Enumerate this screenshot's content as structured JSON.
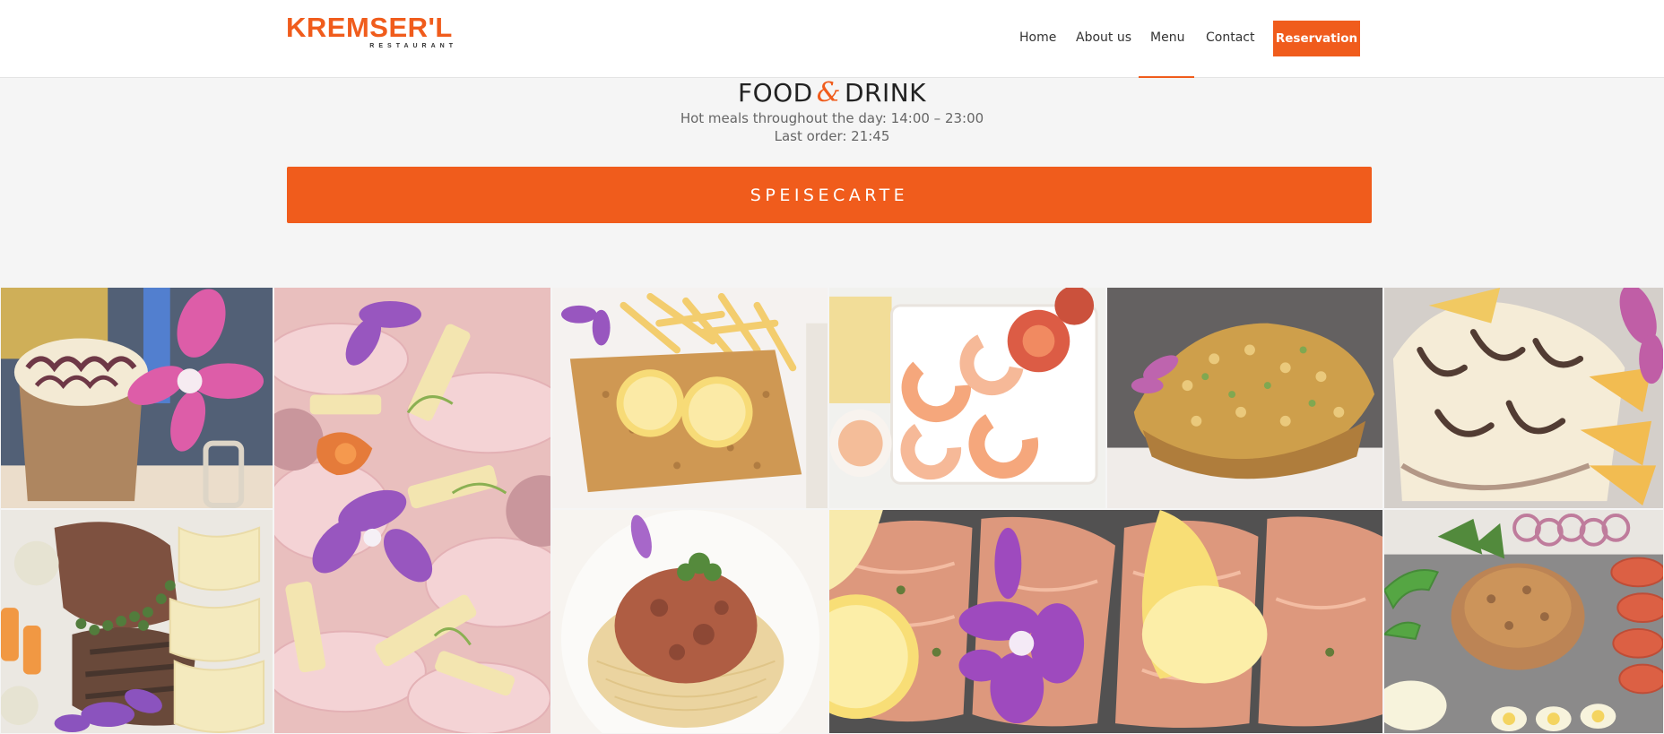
{
  "header": {
    "logo_text": "KREMSER'L",
    "logo_sub": "RESTAURANT",
    "nav": [
      "Home",
      "About us",
      "Menu",
      "Contact"
    ],
    "active_nav": "Menu",
    "reservation_label": "Reservation"
  },
  "section": {
    "title_left": "FOOD",
    "title_amp": "&",
    "title_right": "DRINK",
    "hours_text": "Hot meals throughout the day: 14:00 – 23:00 Last order: 21:45",
    "button_label": "SPEISECARTE"
  },
  "gallery": {
    "tiles": [
      {
        "name": "iced-coffee-dessert-photo",
        "icon": "iced-coffee-with-orchid"
      },
      {
        "name": "cold-cuts-platter-photo",
        "icon": "ham-and-cheese-platter"
      },
      {
        "name": "schnitzel-fries-photo",
        "icon": "schnitzel-with-lemon"
      },
      {
        "name": "shrimp-cocktail-photo",
        "icon": "shrimp-plate"
      },
      {
        "name": "fried-rice-pineapple-photo",
        "icon": "pineapple-fried-rice"
      },
      {
        "name": "sundae-dessert-photo",
        "icon": "ice-cream-sundae"
      },
      {
        "name": "steak-pasta-photo",
        "icon": "pepper-steak-with-pasta"
      },
      {
        "name": "spaghetti-bolognese-photo",
        "icon": "spaghetti-plate"
      },
      {
        "name": "smoked-salmon-photo",
        "icon": "salmon-with-lemon"
      },
      {
        "name": "tartare-plate-photo",
        "icon": "beef-tartare"
      }
    ]
  },
  "colors": {
    "accent": "#f05c1c",
    "text": "#333333",
    "background": "#f5f5f5"
  }
}
